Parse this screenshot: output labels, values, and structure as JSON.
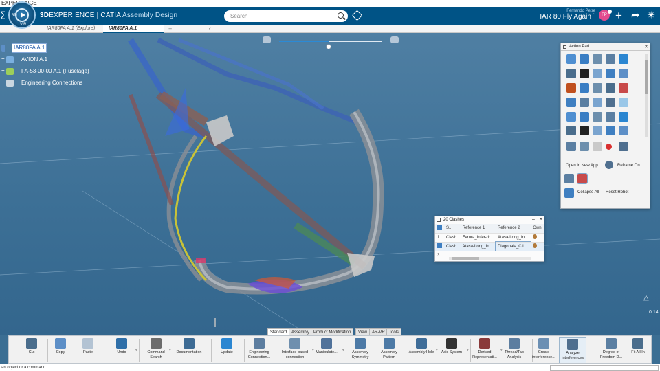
{
  "os_title": "EXPERIENCE",
  "header": {
    "brand_bold": "3D",
    "brand_main": "EXPERIENCE | CATIA",
    "brand_app": "Assembly Design",
    "compass_left": "3D",
    "compass_bottom": "V,R",
    "search_placeholder": "Search",
    "user_name": "Fernando Petre",
    "context": "IAR 80 Fly Again",
    "avatar_initials": "FP"
  },
  "tabs": [
    {
      "label": "IAR80FA A.1 (Explore)"
    },
    {
      "label": "IAR80FA A.1"
    }
  ],
  "tree": [
    {
      "label": "IAR80FA A.1",
      "expand": "",
      "icon_color": "#5d8fc7"
    },
    {
      "label": "AVION A.1",
      "expand": "+",
      "icon_color": "#7bb0e0"
    },
    {
      "label": "FA-53-00-00 A.1 (Fuselage)",
      "expand": "+",
      "icon_color": "#9ccf5a"
    },
    {
      "label": "Engineering Connections",
      "expand": "+",
      "icon_color": "#c9d6e0"
    }
  ],
  "slider": {
    "value": 0.48
  },
  "action_pad": {
    "title": "Action Pad",
    "open_new_app": "Open in New App",
    "reframe_on": "Reframe On",
    "collapse_all": "Collapse All",
    "reset_robot": "Reset Robot"
  },
  "clash": {
    "title": "20 Clashes",
    "headers": [
      "S..",
      "Reference 1",
      "Reference 2",
      "Own"
    ],
    "rows": [
      {
        "num": "1",
        "type": "Clash",
        "ref1": "Ferura_Infer-dr",
        "ref2": "Atasa-Long_In..."
      },
      {
        "num": "2",
        "type": "Clash",
        "ref1": "Atasa-Long_In...",
        "ref2": "Diagonala_C l..."
      },
      {
        "num": "3",
        "type": "",
        "ref1": "",
        "ref2": ""
      }
    ]
  },
  "scale_value": "0.14",
  "section_tabs": [
    "Standard",
    "Assembly",
    "Product Modification",
    "View",
    "AR-VR",
    "Tools"
  ],
  "toolbar": [
    {
      "label": "Cut",
      "color": "#4a6d8c"
    },
    {
      "label": "Copy",
      "color": "#5d8fc7"
    },
    {
      "label": "Paste",
      "color": "#b3c3d3"
    },
    {
      "label": "Undo",
      "color": "#2f6fa8"
    },
    {
      "label": "Command Search",
      "color": "#6c6c6c"
    },
    {
      "label": "Documentation",
      "color": "#3d6b94"
    },
    {
      "label": "Update",
      "color": "#2b86d1"
    },
    {
      "label": "Engineering Connection...",
      "color": "#5d7ea0"
    },
    {
      "label": "Interface-based connection",
      "color": "#6f8fae"
    },
    {
      "label": "Manipulate...",
      "color": "#50729a"
    },
    {
      "label": "Assembly Symmetry",
      "color": "#4d7aa6"
    },
    {
      "label": "Assembly Pattern",
      "color": "#4d7aa6"
    },
    {
      "label": "Assembly Hole",
      "color": "#3f6d98"
    },
    {
      "label": "Axis System",
      "color": "#333333"
    },
    {
      "label": "Derived Representati...",
      "color": "#8a3a3a"
    },
    {
      "label": "Thread/Tap Analysis",
      "color": "#5d7ea0"
    },
    {
      "label": "Create interference...",
      "color": "#6b8fb3"
    },
    {
      "label": "Analyze Interferences",
      "color": "#4f6f8f"
    },
    {
      "label": "Degree of Freedom D...",
      "color": "#5b7fa2"
    },
    {
      "label": "Fit All In",
      "color": "#4a6d8c"
    }
  ],
  "status_text": "an object or a command"
}
